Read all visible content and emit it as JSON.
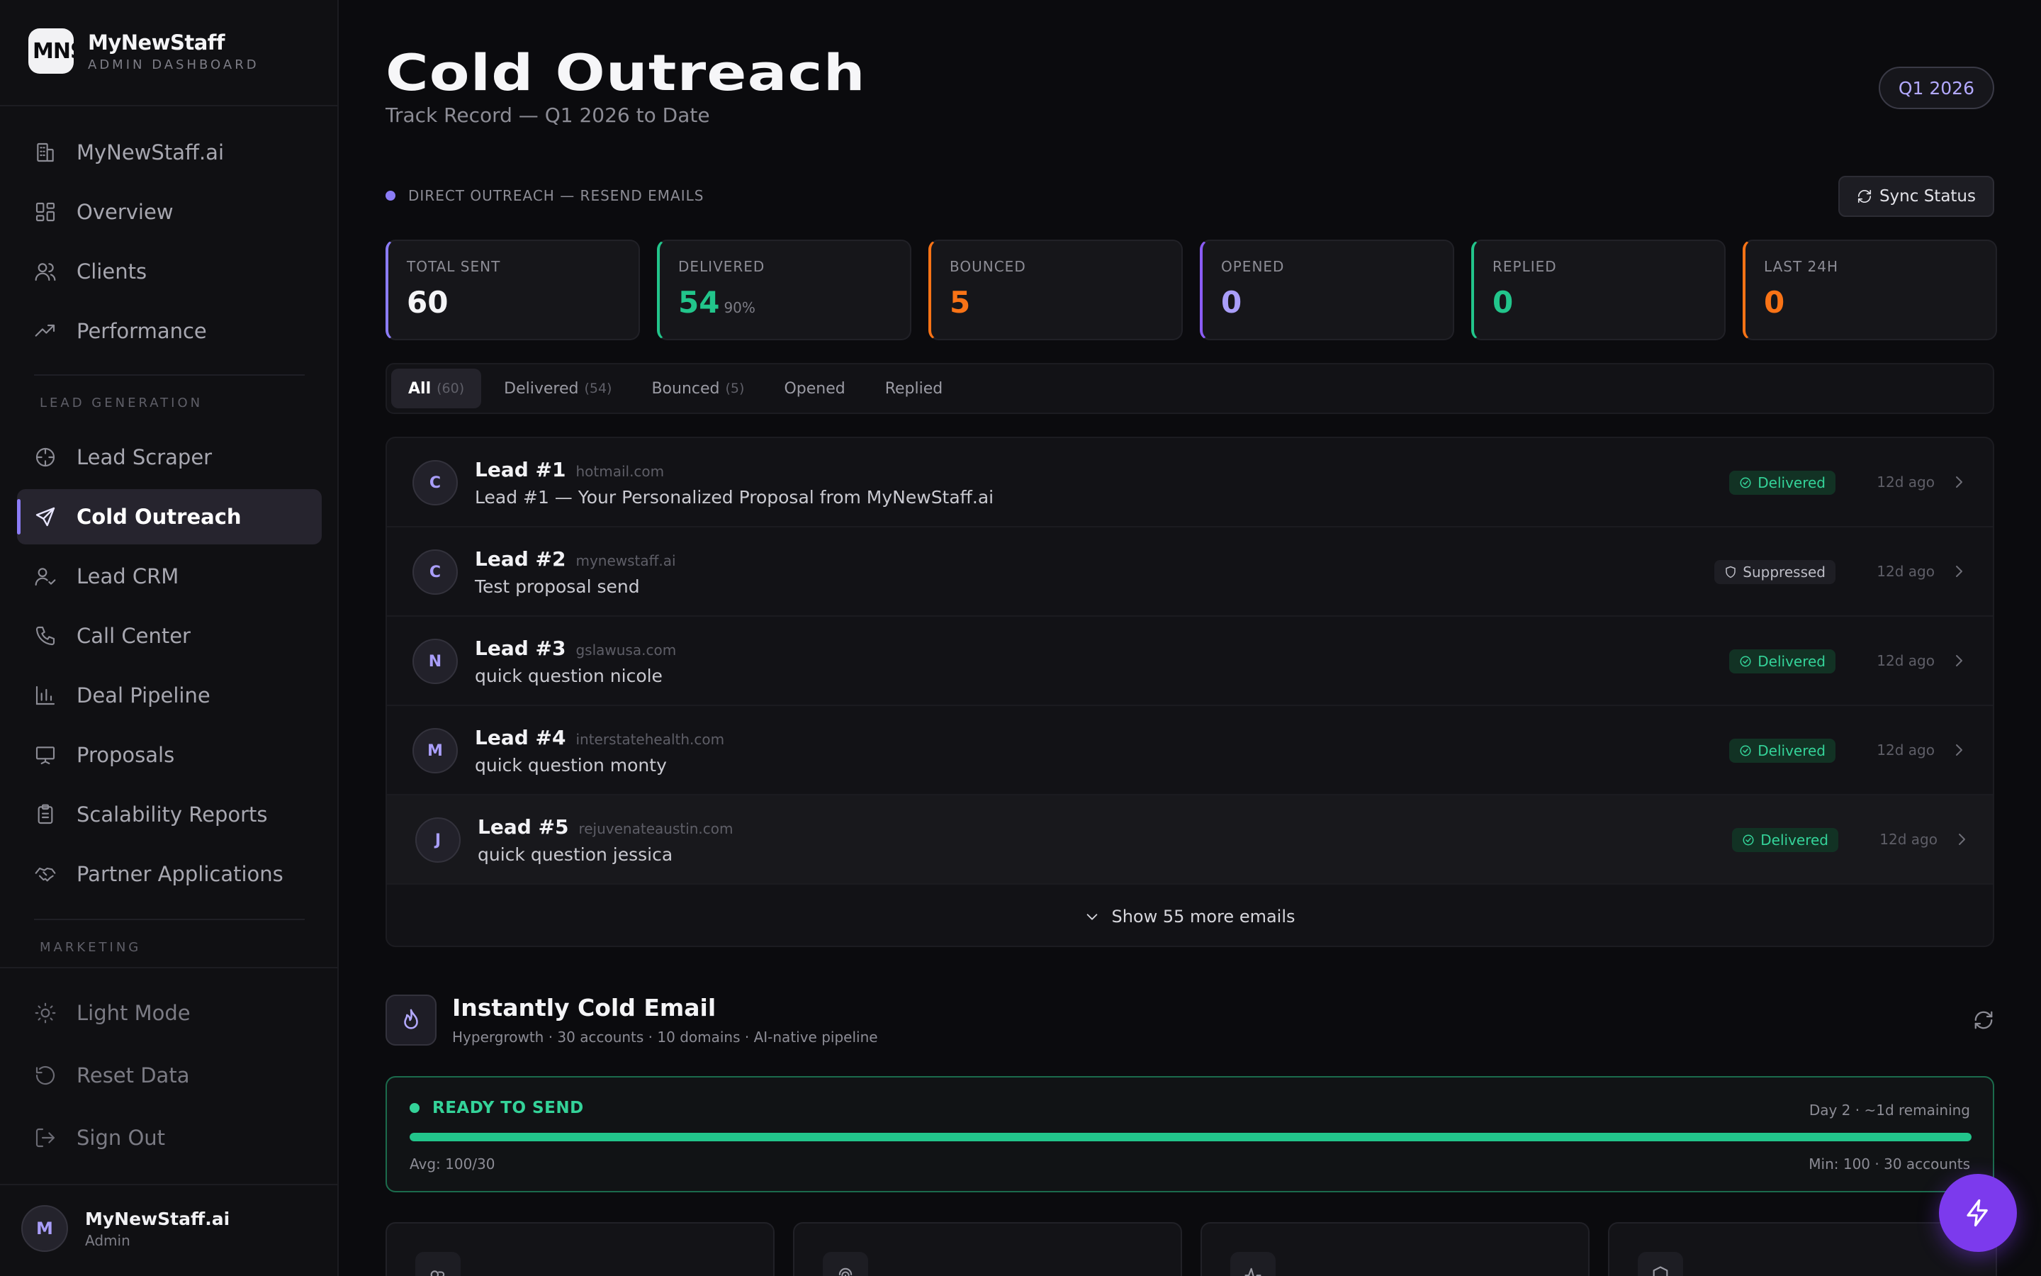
{
  "brand": {
    "logo_text": "MNS",
    "name": "MyNewStaff",
    "subtitle": "ADMIN DASHBOARD"
  },
  "sidebar": {
    "primary": [
      {
        "label": "MyNewStaff.ai",
        "icon": "building-icon"
      },
      {
        "label": "Overview",
        "icon": "grid-icon"
      },
      {
        "label": "Clients",
        "icon": "users-icon"
      },
      {
        "label": "Performance",
        "icon": "trending-up-icon"
      }
    ],
    "section_lead": "LEAD GENERATION",
    "lead": [
      {
        "label": "Lead Scraper",
        "icon": "crosshair-icon"
      },
      {
        "label": "Cold Outreach",
        "icon": "send-icon",
        "active": true
      },
      {
        "label": "Lead CRM",
        "icon": "user-check-icon"
      },
      {
        "label": "Call Center",
        "icon": "phone-icon"
      },
      {
        "label": "Deal Pipeline",
        "icon": "bar-chart-icon"
      },
      {
        "label": "Proposals",
        "icon": "presentation-icon"
      },
      {
        "label": "Scalability Reports",
        "icon": "clipboard-icon"
      },
      {
        "label": "Partner Applications",
        "icon": "handshake-icon"
      }
    ],
    "section_marketing": "MARKETING",
    "footer_items": [
      {
        "label": "Light Mode",
        "icon": "sun-icon"
      },
      {
        "label": "Reset Data",
        "icon": "reset-icon"
      },
      {
        "label": "Sign Out",
        "icon": "sign-out-icon"
      }
    ],
    "user": {
      "initial": "M",
      "name": "MyNewStaff.ai",
      "role": "Admin"
    }
  },
  "header": {
    "title": "Cold Outreach",
    "subtitle": "Track Record — Q1 2026 to Date",
    "quarter": "Q1 2026"
  },
  "outreach": {
    "source_label": "DIRECT OUTREACH — RESEND EMAILS",
    "sync_label": "Sync Status",
    "stats": [
      {
        "label": "TOTAL SENT",
        "value": "60",
        "color": "#8b7cf6",
        "value_color": "#f4f4f6"
      },
      {
        "label": "DELIVERED",
        "value": "54",
        "extra": "90%",
        "color": "#22c58b",
        "value_color": "#22c58b"
      },
      {
        "label": "BOUNCED",
        "value": "5",
        "color": "#f97316",
        "value_color": "#f97316"
      },
      {
        "label": "OPENED",
        "value": "0",
        "color": "#8b5cf6",
        "value_color": "#a99ef9"
      },
      {
        "label": "REPLIED",
        "value": "0",
        "color": "#22c58b",
        "value_color": "#22c58b"
      },
      {
        "label": "LAST 24H",
        "value": "0",
        "color": "#f97316",
        "value_color": "#f97316"
      }
    ],
    "tabs": [
      {
        "label": "All",
        "count": "(60)",
        "active": true
      },
      {
        "label": "Delivered",
        "count": "(54)"
      },
      {
        "label": "Bounced",
        "count": "(5)"
      },
      {
        "label": "Opened",
        "count": ""
      },
      {
        "label": "Replied",
        "count": ""
      }
    ],
    "emails": [
      {
        "initial": "C",
        "name": "Lead #1",
        "domain": "hotmail.com",
        "subject": "Lead #1 — Your Personalized Proposal from MyNewStaff.ai",
        "status": "Delivered",
        "time": "12d ago"
      },
      {
        "initial": "C",
        "name": "Lead #2",
        "domain": "mynewstaff.ai",
        "subject": "Test proposal send",
        "status": "Suppressed",
        "time": "12d ago"
      },
      {
        "initial": "N",
        "name": "Lead #3",
        "domain": "gslawusa.com",
        "subject": "quick question nicole",
        "status": "Delivered",
        "time": "12d ago"
      },
      {
        "initial": "M",
        "name": "Lead #4",
        "domain": "interstatehealth.com",
        "subject": "quick question monty",
        "status": "Delivered",
        "time": "12d ago"
      },
      {
        "initial": "J",
        "name": "Lead #5",
        "domain": "rejuvenateaustin.com",
        "subject": "quick question jessica",
        "status": "Delivered",
        "time": "12d ago"
      }
    ],
    "show_more": "Show 55 more emails"
  },
  "instantly": {
    "title": "Instantly Cold Email",
    "subtitle": "Hypergrowth · 30 accounts · 10 domains · AI-native pipeline",
    "status": "READY TO SEND",
    "day_info": "Day 2 · ~1d remaining",
    "progress": 1.0,
    "avg": "Avg: 100/30",
    "min": "Min: 100 · 30 accounts"
  },
  "colors": {
    "accent": "#8b7cf6",
    "success": "#22c58b",
    "warning": "#f97316",
    "fab": "#7c3aed"
  }
}
